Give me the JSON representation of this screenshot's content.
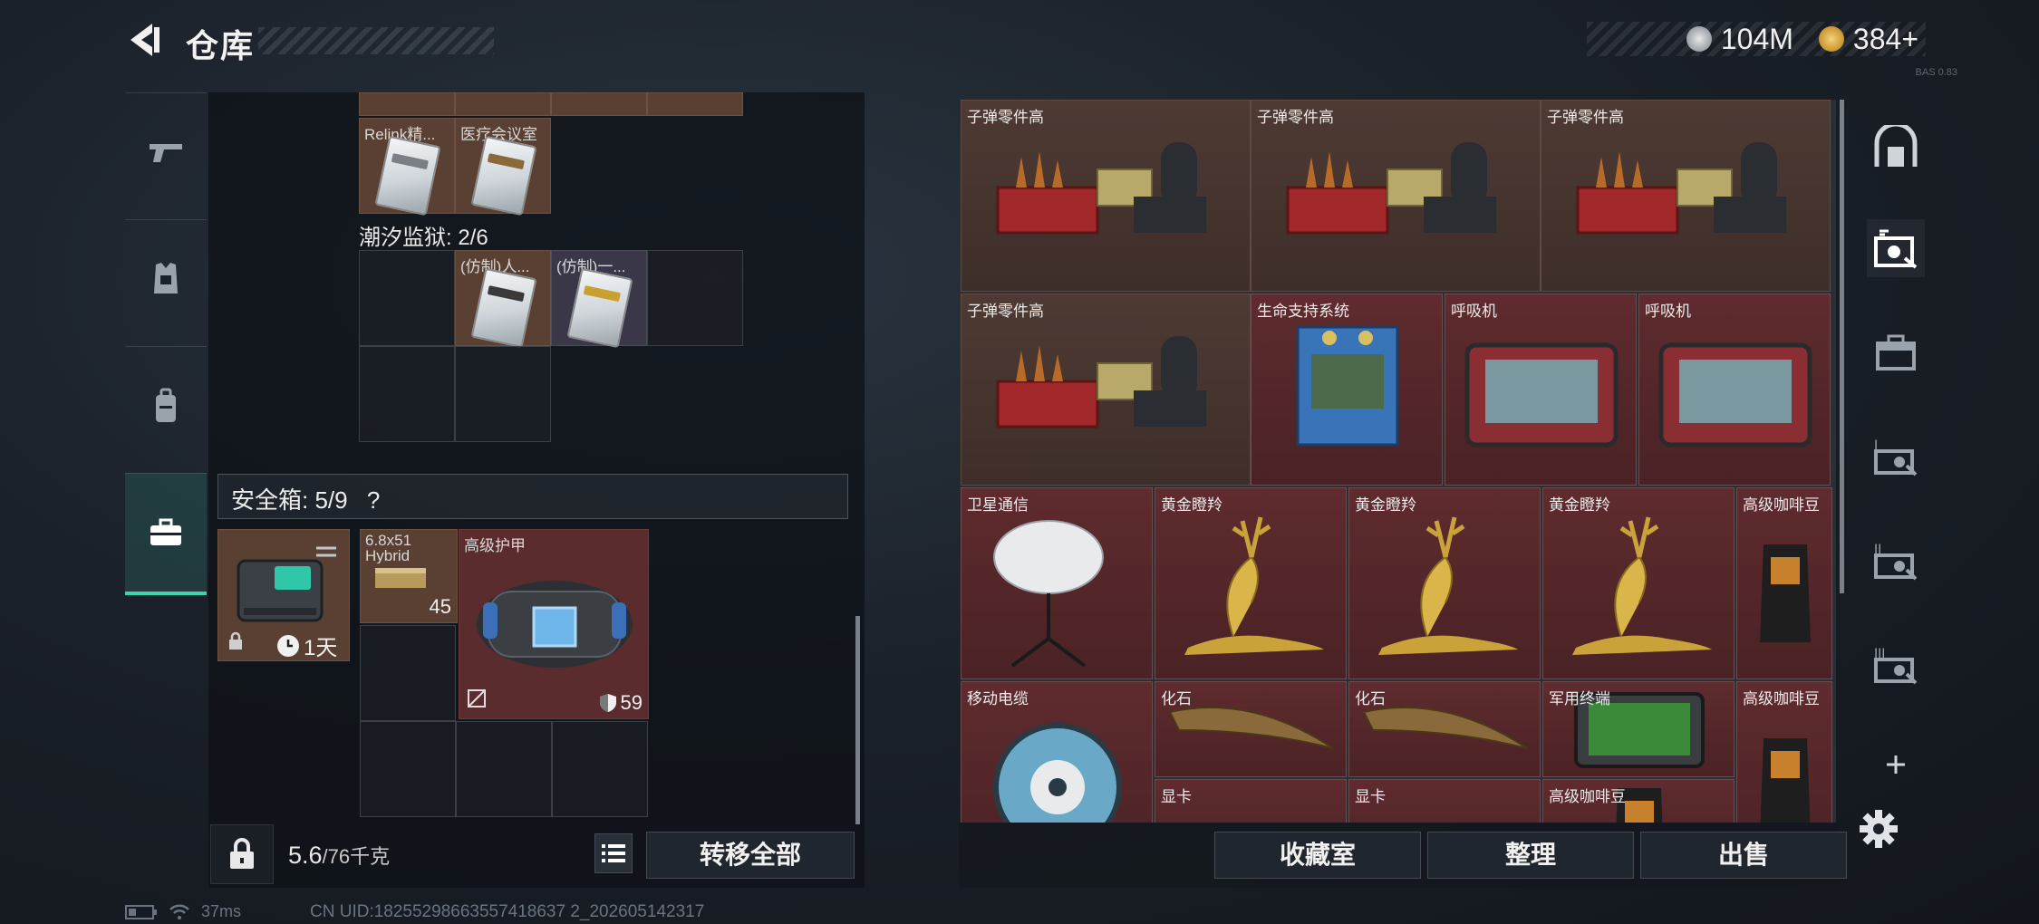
{
  "header": {
    "title": "仓库",
    "currency_1": "104M",
    "currency_2": "384",
    "currency_2_plus": "+",
    "version": "BAS 0.83"
  },
  "left_tabs": [
    "gun-icon",
    "armor-vest-icon",
    "backpack-icon",
    "briefcase-icon"
  ],
  "containers": {
    "top_row_labels": [
      "Relink精...",
      "医疗会议室"
    ],
    "prison_label": "潮汐监狱: 2/6",
    "prison_items": [
      "(仿制)人...",
      "(仿制)一..."
    ],
    "safe_title": "安全箱:  5/9",
    "safe_help": "?",
    "safe_timer": "1天",
    "ammo_label": "6.8x51 Hybrid",
    "ammo_count": "45",
    "armor_label": "高级护甲",
    "armor_durability": "59"
  },
  "footer_left": {
    "weight": "5.6",
    "weight_max": "/76千克",
    "transfer_all": "转移全部"
  },
  "stash_items": [
    {
      "label": "子弹零件高",
      "tone": "brown"
    },
    {
      "label": "子弹零件高",
      "tone": "brown"
    },
    {
      "label": "子弹零件高",
      "tone": "brown"
    },
    {
      "label": "子弹零件高",
      "tone": "brown"
    },
    {
      "label": "生命支持系统",
      "tone": "red"
    },
    {
      "label": "呼吸机",
      "tone": "red"
    },
    {
      "label": "呼吸机",
      "tone": "red"
    },
    {
      "label": "卫星通信",
      "tone": "red"
    },
    {
      "label": "黄金瞪羚",
      "tone": "red"
    },
    {
      "label": "黄金瞪羚",
      "tone": "red"
    },
    {
      "label": "黄金瞪羚",
      "tone": "red"
    },
    {
      "label": "高级咖啡豆",
      "tone": "red"
    },
    {
      "label": "移动电缆",
      "tone": "red"
    },
    {
      "label": "化石",
      "tone": "red"
    },
    {
      "label": "化石",
      "tone": "red"
    },
    {
      "label": "军用终端",
      "tone": "red"
    },
    {
      "label": "高级咖啡豆",
      "tone": "red"
    },
    {
      "label": "显卡",
      "tone": "red"
    },
    {
      "label": "显卡",
      "tone": "red"
    },
    {
      "label": "高级咖啡豆",
      "tone": "red"
    }
  ],
  "footer_right": {
    "collection": "收藏室",
    "organize": "整理",
    "sell": "出售"
  },
  "right_tabs": [
    "vault-icon",
    "stash-sorted-icon",
    "stash-icon",
    "stash-1-icon",
    "stash-2-icon",
    "stash-3-icon",
    "add-icon"
  ],
  "status": {
    "ping": "37ms",
    "uid": "CN UID:18255298663557418637 2_202605142317"
  },
  "colors": {
    "accent": "#3fd3b0",
    "item_red": "#5f2b2e",
    "item_brown": "#4e3a33"
  }
}
